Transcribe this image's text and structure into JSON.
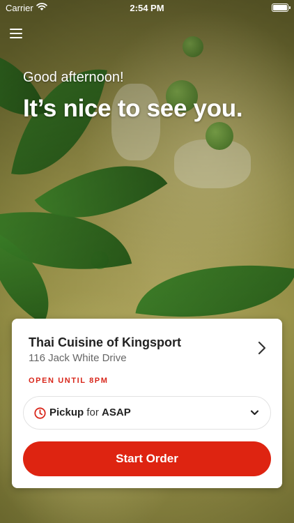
{
  "status_bar": {
    "carrier": "Carrier",
    "time": "2:54 PM"
  },
  "header": {
    "greeting": "Good afternoon!",
    "welcome": "It’s nice to see you."
  },
  "location": {
    "name": "Thai Cuisine of Kingsport",
    "address": "116 Jack White Drive",
    "hours_status": "OPEN UNTIL 8PM"
  },
  "order_options": {
    "type": "Pickup",
    "connector": "for",
    "time": "ASAP"
  },
  "actions": {
    "start_order": "Start Order"
  },
  "colors": {
    "accent": "#de2411",
    "status_text": "#d8261a"
  },
  "icons": [
    "menu-icon",
    "wifi-icon",
    "battery-icon",
    "chevron-right-icon",
    "clock-icon",
    "chevron-down-icon"
  ]
}
